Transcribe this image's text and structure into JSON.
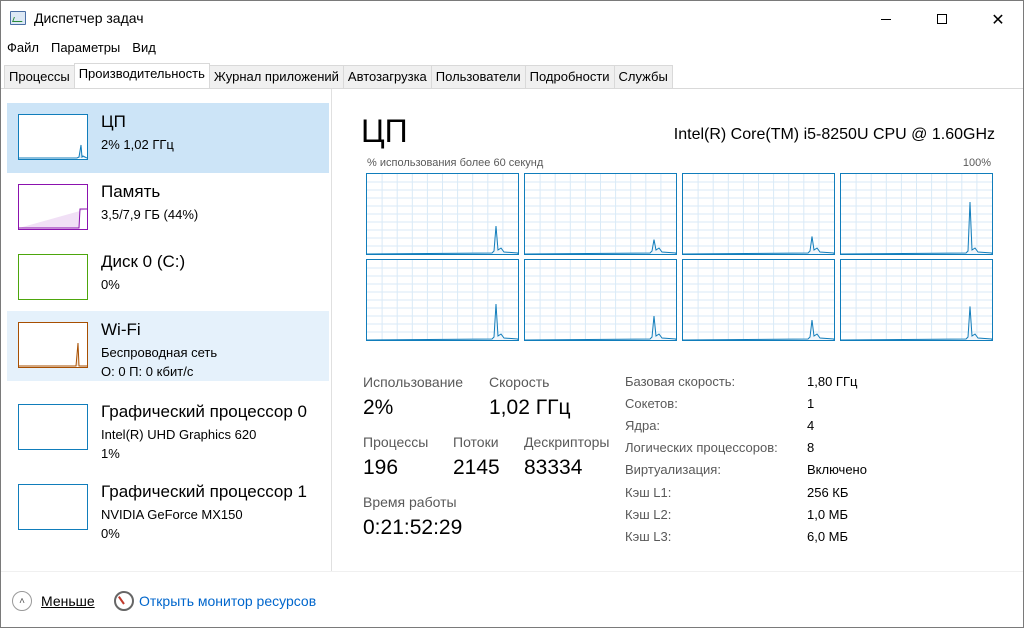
{
  "window": {
    "title": "Диспетчер задач",
    "minimize_icon": "minimize-icon",
    "maximize_icon": "maximize-icon",
    "close_icon": "close-icon"
  },
  "menu": [
    "Файл",
    "Параметры",
    "Вид"
  ],
  "tabs": [
    {
      "label": "Процессы",
      "active": false
    },
    {
      "label": "Производительность",
      "active": true
    },
    {
      "label": "Журнал приложений",
      "active": false
    },
    {
      "label": "Автозагрузка",
      "active": false
    },
    {
      "label": "Пользователи",
      "active": false
    },
    {
      "label": "Подробности",
      "active": false
    },
    {
      "label": "Службы",
      "active": false
    }
  ],
  "resources": [
    {
      "name": "ЦП",
      "sub1": "2% 1,02 ГГц",
      "sub2": "",
      "color": "#117dbb",
      "state": "selected"
    },
    {
      "name": "Память",
      "sub1": "3,5/7,9 ГБ (44%)",
      "sub2": "",
      "color": "#8b12ae",
      "state": "normal"
    },
    {
      "name": "Диск 0 (C:)",
      "sub1": "0%",
      "sub2": "",
      "color": "#4da60c",
      "state": "normal"
    },
    {
      "name": "Wi-Fi",
      "sub1": "Беспроводная сеть",
      "sub2": "О: 0 П: 0 кбит/с",
      "color": "#a74f01",
      "state": "hover"
    },
    {
      "name": "Графический процессор 0",
      "sub1": "Intel(R) UHD Graphics 620",
      "sub2": "1%",
      "color": "#117dbb",
      "state": "normal"
    },
    {
      "name": "Графический процессор 1",
      "sub1": "NVIDIA GeForce MX150",
      "sub2": "0%",
      "color": "#117dbb",
      "state": "normal"
    }
  ],
  "cpu": {
    "title": "ЦП",
    "model": "Intel(R) Core(TM) i5-8250U CPU @ 1.60GHz",
    "graph_label": "% использования более 60 секунд",
    "graph_max": "100%",
    "graph_color": "#117dbb",
    "grid_color": "#d9eaf7"
  },
  "stats": {
    "usage_label": "Использование",
    "usage_value": "2%",
    "speed_label": "Скорость",
    "speed_value": "1,02 ГГц",
    "processes_label": "Процессы",
    "processes_value": "196",
    "threads_label": "Потоки",
    "threads_value": "2145",
    "handles_label": "Дескрипторы",
    "handles_value": "83334",
    "uptime_label": "Время работы",
    "uptime_value": "0:21:52:29"
  },
  "specs": [
    {
      "label": "Базовая скорость:",
      "value": "1,80 ГГц"
    },
    {
      "label": "Сокетов:",
      "value": "1"
    },
    {
      "label": "Ядра:",
      "value": "4"
    },
    {
      "label": "Логических процессоров:",
      "value": "8"
    },
    {
      "label": "Виртуализация:",
      "value": "Включено"
    },
    {
      "label": "Кэш L1:",
      "value": "256 КБ"
    },
    {
      "label": "Кэш L2:",
      "value": "1,0 МБ"
    },
    {
      "label": "Кэш L3:",
      "value": "6,0 МБ"
    }
  ],
  "footer": {
    "less_label": "Меньше",
    "monitor_label": "Открыть монитор ресурсов",
    "less_icon": "chevron-up-icon",
    "monitor_icon": "resource-monitor-icon"
  }
}
